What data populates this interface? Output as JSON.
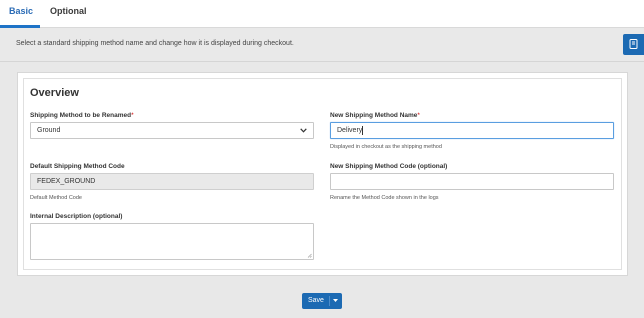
{
  "tabs": [
    {
      "label": "Basic",
      "active": true
    },
    {
      "label": "Optional",
      "active": false
    }
  ],
  "info": {
    "text": "Select a standard shipping method name and change how it is displayed during checkout."
  },
  "overview": {
    "title": "Overview"
  },
  "form": {
    "shipping_method": {
      "label": "Shipping Method to be Renamed",
      "required_mark": "*",
      "value": "Ground"
    },
    "new_name": {
      "label": "New Shipping Method Name",
      "required_mark": "*",
      "value": "Delivery",
      "help": "Displayed in checkout as the shipping method"
    },
    "default_code": {
      "label": "Default Shipping Method Code",
      "value": "FEDEX_GROUND",
      "help": "Default Method Code"
    },
    "new_code": {
      "label": "New Shipping Method Code (optional)",
      "value": "",
      "help": "Rename the Method Code shown in the logs"
    },
    "internal_description": {
      "label": "Internal Description (optional)",
      "value": ""
    }
  },
  "actions": {
    "save_label": "Save"
  },
  "icons": {
    "side_panel": "bookmark-icon",
    "select_chevron": "chevron-down-icon",
    "save_dropdown": "caret-down-icon"
  },
  "colors": {
    "accent": "#1c6ab3",
    "active_tab": "#2a6bb5",
    "required": "#cc0000"
  }
}
